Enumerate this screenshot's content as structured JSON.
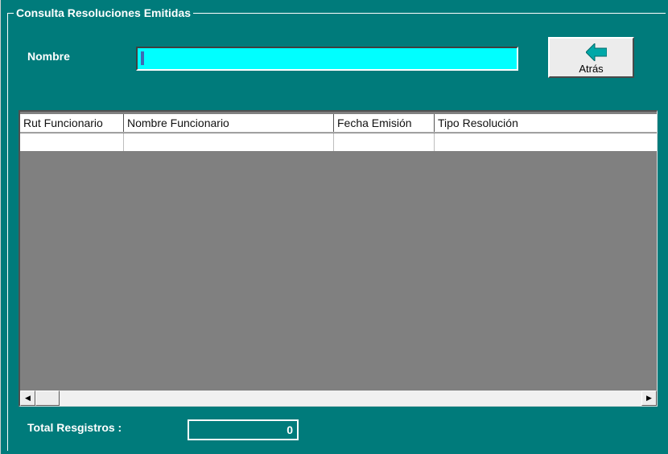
{
  "form": {
    "frame_title": "Consulta Resoluciones Emitidas",
    "name_label": "Nombre",
    "name_value": "",
    "back_button_label": "Atrás",
    "back_icon": "back-arrow-icon",
    "input_color": "#00ffff",
    "background_color": "#007b7b"
  },
  "grid": {
    "columns": [
      "Rut Funcionario",
      "Nombre Funcionario",
      "Fecha Emisión",
      "Tipo Resolución"
    ],
    "rows": [
      [
        "",
        "",
        "",
        ""
      ]
    ]
  },
  "footer": {
    "total_label": "Total Resgistros :",
    "total_value": "0"
  }
}
